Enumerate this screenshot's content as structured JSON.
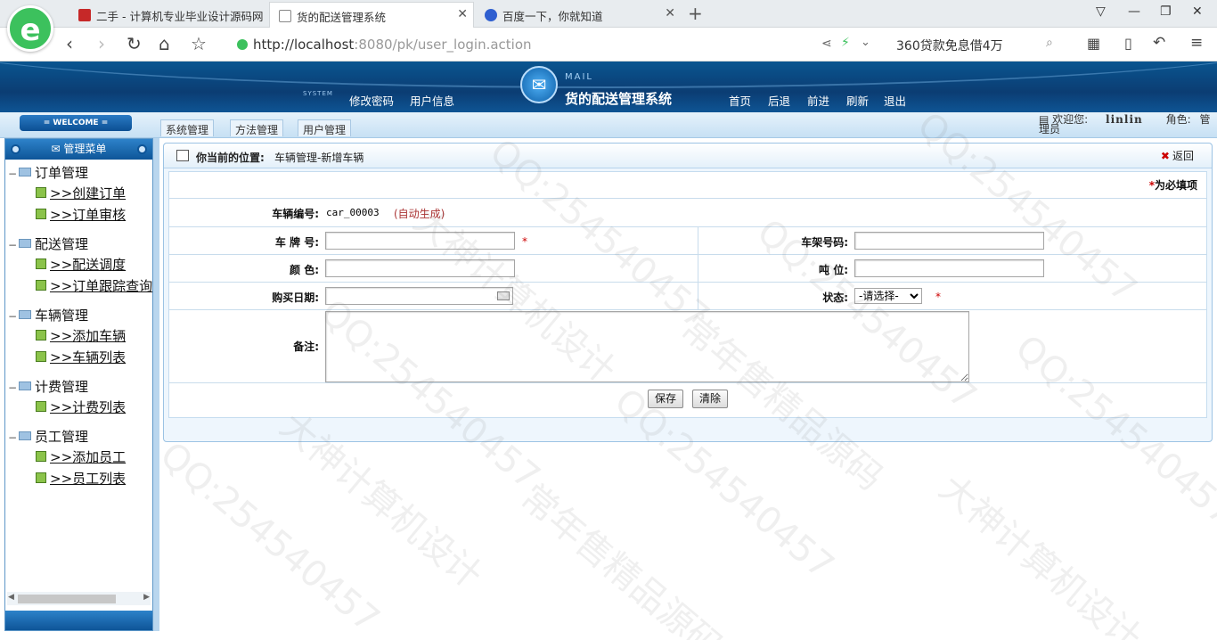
{
  "browser": {
    "tabs": [
      {
        "label": "二手 - 计算机专业毕业设计源码网",
        "active": false
      },
      {
        "label": "货的配送管理系统",
        "active": true
      },
      {
        "label": "百度一下，你就知道",
        "active": false
      }
    ],
    "logo_glyph": "e",
    "url_host": "http://localhost",
    "url_path": ":8080/pk/user_login.action",
    "search_text": "360贷款免息借4万",
    "new_tab_glyph": "+",
    "minimize_glyph": "—",
    "maximize_glyph": "❐",
    "close_glyph": "✕"
  },
  "header": {
    "system_label": "SYSTEM",
    "left_links": [
      "修改密码",
      "用户信息"
    ],
    "mail_label": "MAIL",
    "app_title": "货的配送管理系统",
    "right_links": [
      "首页",
      "后退",
      "前进",
      "刷新",
      "退出"
    ]
  },
  "subbar": {
    "welcome": "= WELCOME =",
    "tabs": [
      "系统管理",
      "方法管理",
      "用户管理"
    ],
    "welcome_prefix": "欢迎您:",
    "username": "linlin",
    "role_label": "角色:",
    "role_value": "管",
    "welcome_suffix": "理员"
  },
  "sidebar": {
    "title": "管理菜单",
    "groups": [
      {
        "label": "订单管理",
        "items": [
          ">>创建订单",
          ">>订单审核"
        ]
      },
      {
        "label": "配送管理",
        "items": [
          ">>配送调度",
          ">>订单跟踪查询"
        ]
      },
      {
        "label": "车辆管理",
        "items": [
          ">>添加车辆",
          ">>车辆列表"
        ]
      },
      {
        "label": "计费管理",
        "items": [
          ">>计费列表"
        ]
      },
      {
        "label": "员工管理",
        "items": [
          ">>添加员工",
          ">>员工列表"
        ]
      }
    ]
  },
  "main": {
    "location_label": "你当前的位置:",
    "location_value": "车辆管理-新增车辆",
    "back_label": "返回",
    "required_note": "为必填项",
    "form": {
      "vehicle_no_label": "车辆编号:",
      "vehicle_no_value": "car_00003",
      "vehicle_no_hint": "(自动生成)",
      "plate_label": "车 牌 号:",
      "plate_value": "",
      "frame_label": "车架号码:",
      "frame_value": "",
      "color_label": "颜  色:",
      "color_value": "",
      "tonnage_label": "吨  位:",
      "tonnage_value": "",
      "buy_date_label": "购买日期:",
      "buy_date_value": "",
      "status_label": "状态:",
      "status_selected": "-请选择-",
      "remark_label": "备注:",
      "remark_value": "",
      "save_button": "保存",
      "clear_button": "清除"
    }
  },
  "watermark": {
    "texts": [
      "QQ:254540457",
      "大神计算机设计",
      "常年售精品源码"
    ]
  },
  "colors": {
    "header_blue": "#0b3d73",
    "required_red": "#cc0000",
    "hint_red": "#a33",
    "accent_green": "#3cc15d"
  }
}
